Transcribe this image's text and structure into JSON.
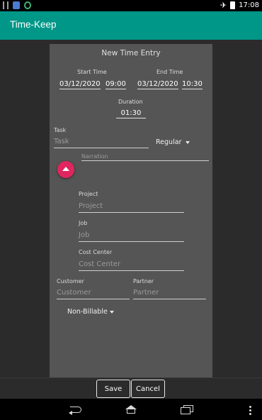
{
  "status_bar": {
    "time": "17:08"
  },
  "app": {
    "title": "Time-Keep"
  },
  "dialog": {
    "title": "New Time Entry",
    "start_time_label": "Start Time",
    "start_date": "03/12/2020",
    "start_time": "09:00",
    "end_time_label": "End Time",
    "end_date": "03/12/2020",
    "end_time": "10:30",
    "duration_label": "Duration",
    "duration": "01:30",
    "task_label": "Task",
    "task_placeholder": "Task",
    "task_type": "Regular",
    "narration_placeholder": "Narration",
    "project_label": "Project",
    "project_placeholder": "Project",
    "job_label": "Job",
    "job_placeholder": "Job",
    "cost_center_label": "Cost Center",
    "cost_center_placeholder": "Cost Center",
    "customer_label": "Customer",
    "customer_placeholder": "Customer",
    "partner_label": "Partner",
    "partner_placeholder": "Partner",
    "billing": "Non-Billable"
  },
  "actions": {
    "save": "Save",
    "cancel": "Cancel"
  },
  "colors": {
    "app_bar": "#009688",
    "fab": "#e0265f",
    "dialog": "#555555"
  }
}
